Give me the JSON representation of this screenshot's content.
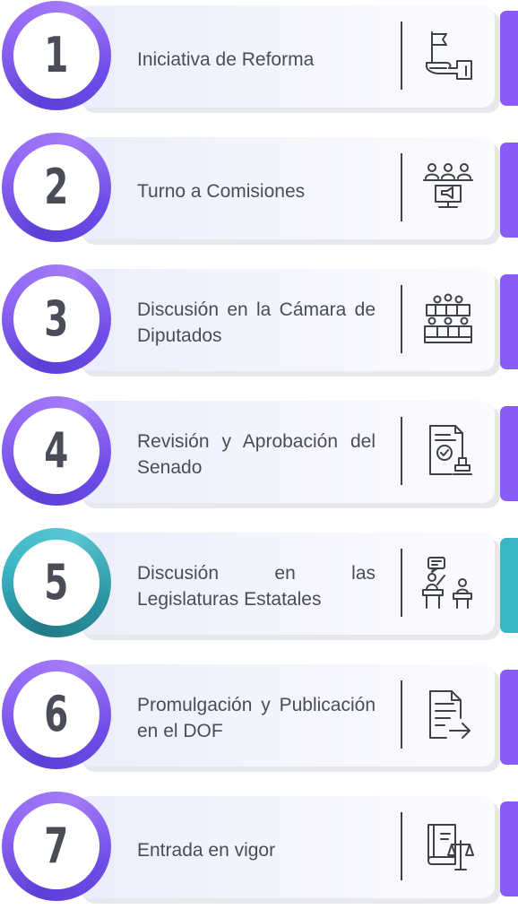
{
  "steps": [
    {
      "number": "1",
      "label": "Iniciativa de Reforma",
      "icon": "hand-flag-icon",
      "color": "#8a5cf6"
    },
    {
      "number": "2",
      "label": "Turno a Comisiones",
      "icon": "committee-meeting-icon",
      "color": "#8a5cf6"
    },
    {
      "number": "3",
      "label": "Discusión en la Cámara de Diputados",
      "icon": "chamber-seats-icon",
      "color": "#8a5cf6"
    },
    {
      "number": "4",
      "label": "Revisión y Aprobación del Senado",
      "icon": "approved-document-stamp-icon",
      "color": "#8a5cf6"
    },
    {
      "number": "5",
      "label": "Discusión en las Legislaturas Estatales",
      "icon": "debate-podium-icon",
      "color": "#3ab5c4"
    },
    {
      "number": "6",
      "label": "Promulgación y Publicación en el DOF",
      "icon": "document-publish-icon",
      "color": "#8a5cf6"
    },
    {
      "number": "7",
      "label": "Entrada en vigor",
      "icon": "law-book-scales-icon",
      "color": "#8a5cf6"
    }
  ]
}
